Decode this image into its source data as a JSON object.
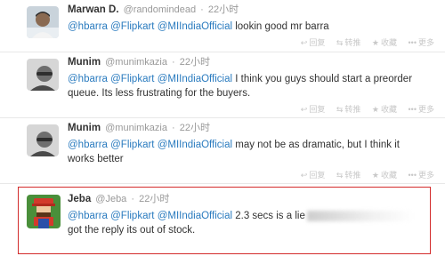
{
  "tweets": [
    {
      "fullname": "Marwan D.",
      "username": "@randomindead",
      "time": "22小时",
      "mentions": [
        "@hbarra",
        "@Flipkart",
        "@MIIndiaOfficial"
      ],
      "text": "lookin good mr barra",
      "actions": [
        "回复",
        "转推",
        "收藏",
        "更多"
      ]
    },
    {
      "fullname": "Munim",
      "username": "@munimkazia",
      "time": "22小时",
      "mentions": [
        "@hbarra",
        "@Flipkart",
        "@MIIndiaOfficial"
      ],
      "text": "I think you guys should start a preorder queue. Its less frustrating for the buyers.",
      "actions": [
        "回复",
        "转推",
        "收藏",
        "更多"
      ]
    },
    {
      "fullname": "Munim",
      "username": "@munimkazia",
      "time": "22小时",
      "mentions": [
        "@hbarra",
        "@Flipkart",
        "@MIIndiaOfficial"
      ],
      "text": "may not be as dramatic, but I think it works better",
      "actions": [
        "回复",
        "转推",
        "收藏",
        "更多"
      ]
    },
    {
      "fullname": "Jeba",
      "username": "@Jeba",
      "time": "22小时",
      "mentions": [
        "@hbarra",
        "@Flipkart",
        "@MIIndiaOfficial"
      ],
      "text": "2.3 secs is a lie",
      "text2": "got the reply its out of stock.",
      "highlight_color": "#d32c2c"
    }
  ],
  "colors": {
    "mention": "#2a7bbf",
    "meta": "#999999",
    "highlight": "#d32c2c"
  }
}
